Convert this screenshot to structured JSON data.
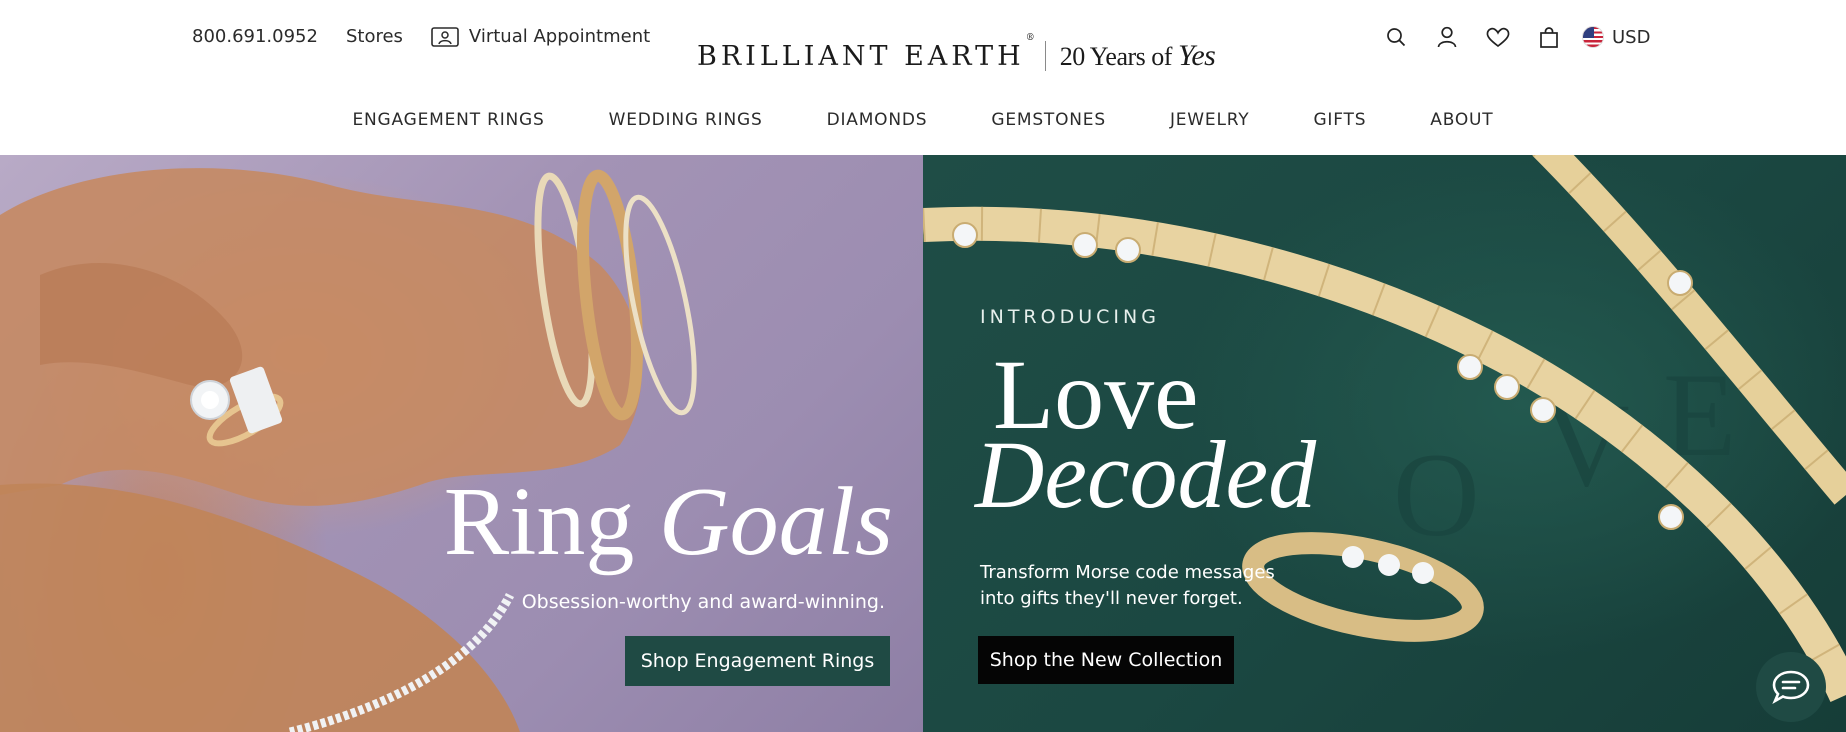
{
  "header": {
    "phone": "800.691.0952",
    "stores": "Stores",
    "virtual_appointment": "Virtual Appointment",
    "logo": {
      "brand": "BRILLIANT EARTH",
      "registered": "®",
      "tagline_prefix": "20 Years of",
      "tagline_script": "Yes"
    },
    "icons": [
      "search-icon",
      "account-icon",
      "heart-icon",
      "bag-icon"
    ],
    "currency": "USD"
  },
  "nav": {
    "items": [
      {
        "label": "ENGAGEMENT RINGS"
      },
      {
        "label": "WEDDING RINGS"
      },
      {
        "label": "DIAMONDS"
      },
      {
        "label": "GEMSTONES"
      },
      {
        "label": "JEWELRY"
      },
      {
        "label": "GIFTS"
      },
      {
        "label": "ABOUT"
      }
    ]
  },
  "hero_left": {
    "title_plain": "Ring",
    "title_italic": "Goals",
    "subtitle": "Obsession-worthy and award-winning.",
    "cta": "Shop Engagement Rings",
    "cta_color": "#1f4a44"
  },
  "hero_right": {
    "eyebrow": "INTRODUCING",
    "title_line1": "Love",
    "title_line2": "Decoded",
    "subtitle": "Transform Morse code messages into gifts they'll never forget.",
    "cta": "Shop the New Collection",
    "cta_color": "#050505"
  },
  "chat": {
    "icon": "chat-icon",
    "color": "#1f4a44"
  }
}
